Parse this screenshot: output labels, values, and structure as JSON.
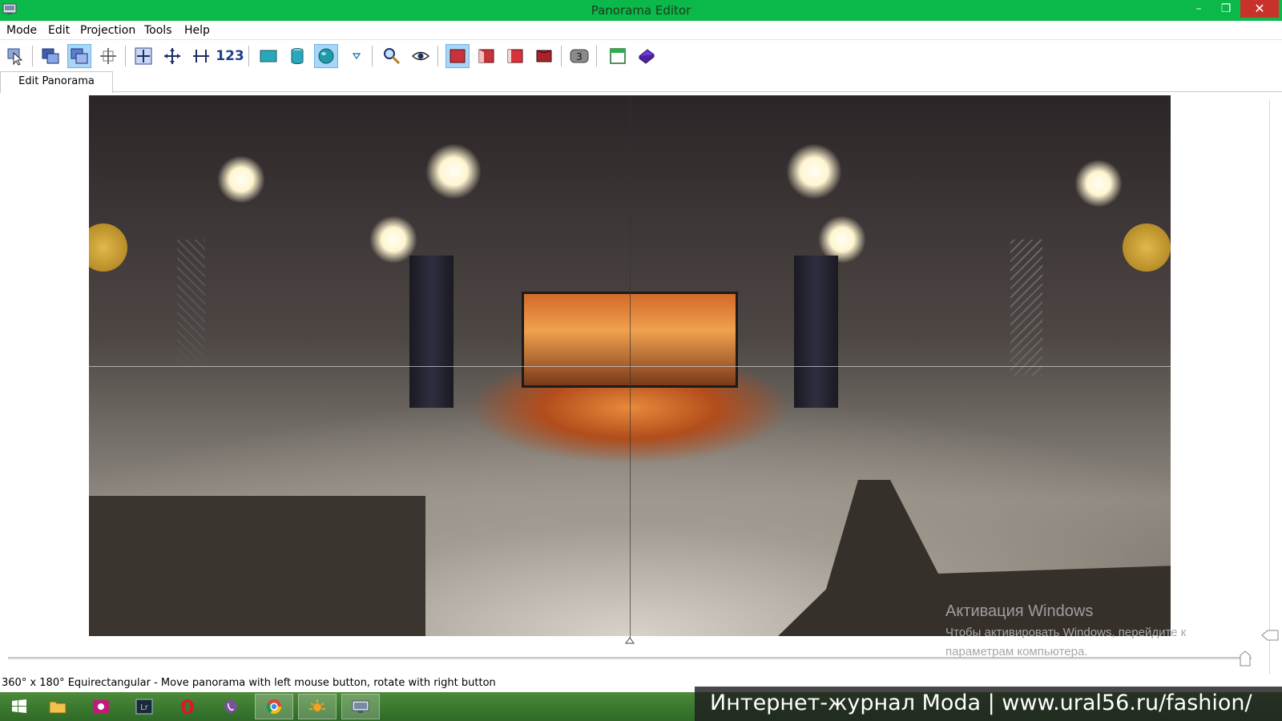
{
  "window": {
    "title": "Panorama Editor",
    "controls": {
      "minimize": "–",
      "maximize": "❐",
      "close": "✕"
    }
  },
  "menu": [
    "Mode",
    "Edit",
    "Projection",
    "Tools",
    "Help"
  ],
  "toolbar": {
    "buttons": [
      {
        "icon": "select-arrow-icon",
        "active": false
      },
      {
        "icon": "images-icon",
        "active": false
      },
      {
        "icon": "overlap-icon",
        "active": true
      },
      {
        "icon": "crop-icon",
        "active": false
      },
      {
        "icon": "center-icon",
        "active": false
      },
      {
        "icon": "move-icon",
        "active": false
      },
      {
        "icon": "straighten-icon",
        "active": false
      },
      {
        "icon": "control-points-icon",
        "label": "123",
        "active": false
      },
      {
        "icon": "rectilinear-projection-icon",
        "active": false
      },
      {
        "icon": "cylindrical-projection-icon",
        "active": false
      },
      {
        "icon": "spherical-projection-icon",
        "active": true
      },
      {
        "icon": "dropdown-triangle-icon",
        "active": false
      },
      {
        "icon": "zoom-icon",
        "active": false
      },
      {
        "icon": "preview-eye-icon",
        "active": false
      },
      {
        "icon": "blend-mode-1-icon",
        "active": true
      },
      {
        "icon": "blend-mode-2-icon",
        "active": false
      },
      {
        "icon": "blend-mode-3-icon",
        "active": false
      },
      {
        "icon": "blend-mode-4-icon",
        "active": false
      },
      {
        "icon": "layer-count-icon",
        "label": "3",
        "active": false
      },
      {
        "icon": "window-icon",
        "active": false
      },
      {
        "icon": "book-icon",
        "active": false
      }
    ]
  },
  "tabs": [
    {
      "label": "Edit Panorama",
      "active": true
    }
  ],
  "watermark": {
    "title": "Активация Windows",
    "line1": "Чтобы активировать Windows, перейдите к",
    "line2": "параметрам компьютера."
  },
  "status": {
    "text": "360° x 180° Equirectangular - Move panorama with left mouse button, rotate with right button"
  },
  "taskbar": {
    "apps": [
      {
        "icon": "windows-start-icon",
        "open": false
      },
      {
        "icon": "file-explorer-icon",
        "open": false
      },
      {
        "icon": "camera-app-icon",
        "open": false
      },
      {
        "icon": "lightroom-icon",
        "label": "Lr",
        "open": false
      },
      {
        "icon": "opera-icon",
        "open": false
      },
      {
        "icon": "viber-icon",
        "open": false
      },
      {
        "icon": "chrome-icon",
        "open": true
      },
      {
        "icon": "sun-app-icon",
        "open": true
      },
      {
        "icon": "panorama-editor-icon",
        "open": true
      }
    ]
  },
  "overlay": {
    "text": "Интернет-журнал Moda | www.ural56.ru/fashion/"
  },
  "colors": {
    "titlebar": "#0bb84a",
    "close": "#c9312b",
    "active_button": "#a9d6f7"
  }
}
